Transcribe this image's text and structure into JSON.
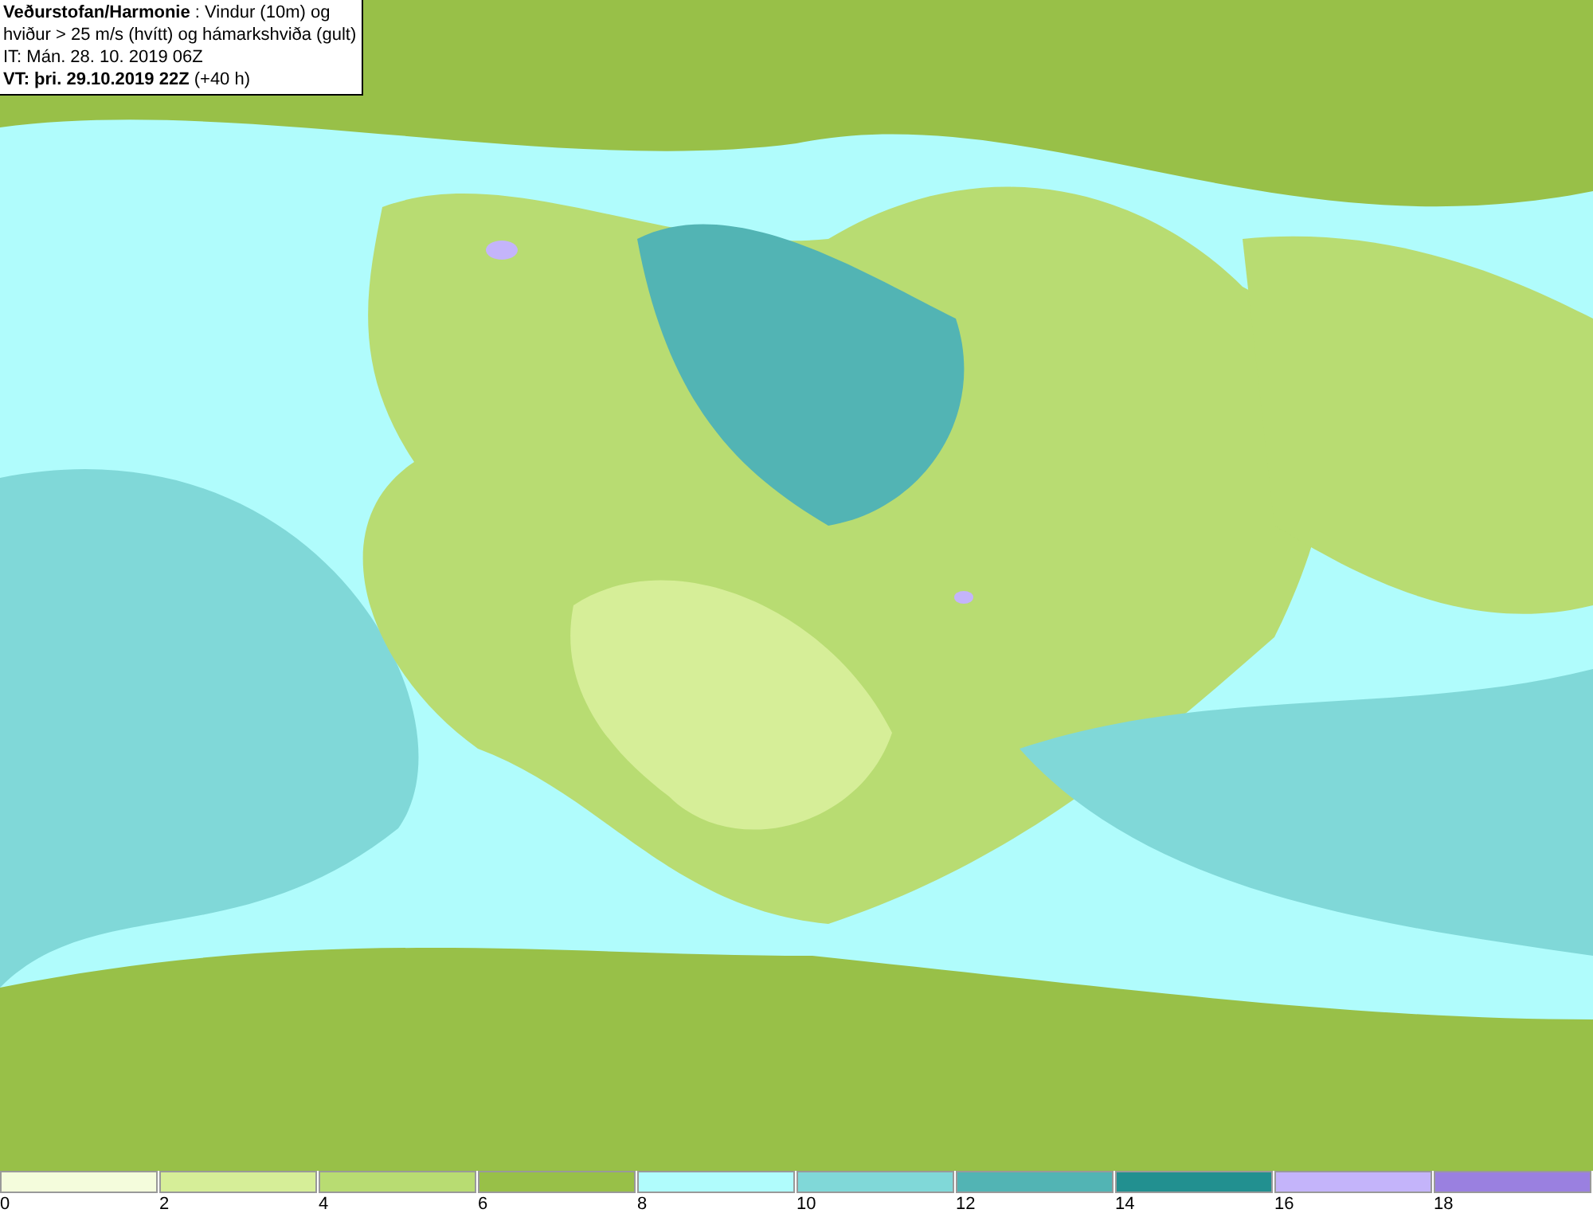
{
  "header": {
    "lines": [
      "**Veðurstofan/Harmonie** : Vindur (10m) og",
      "hviður > 25 m/s (hvítt) og hámarkshviða (gult)",
      "IT: Mán. 28. 10. 2019 06Z",
      "**VT: þri. 29.10.2019 22Z** (+40 h)"
    ]
  },
  "legend": [
    {
      "label": "0",
      "color": "#f4fcdc"
    },
    {
      "label": "2",
      "color": "#d6ee98"
    },
    {
      "label": "4",
      "color": "#b8dc72"
    },
    {
      "label": "6",
      "color": "#98c048"
    },
    {
      "label": "8",
      "color": "#b0fcfc"
    },
    {
      "label": "10",
      "color": "#80d8d8"
    },
    {
      "label": "12",
      "color": "#52b4b4"
    },
    {
      "label": "14",
      "color": "#229090"
    },
    {
      "label": "16",
      "color": "#c4b4fa"
    },
    {
      "label": "18",
      "color": "#9a80e0"
    }
  ]
}
